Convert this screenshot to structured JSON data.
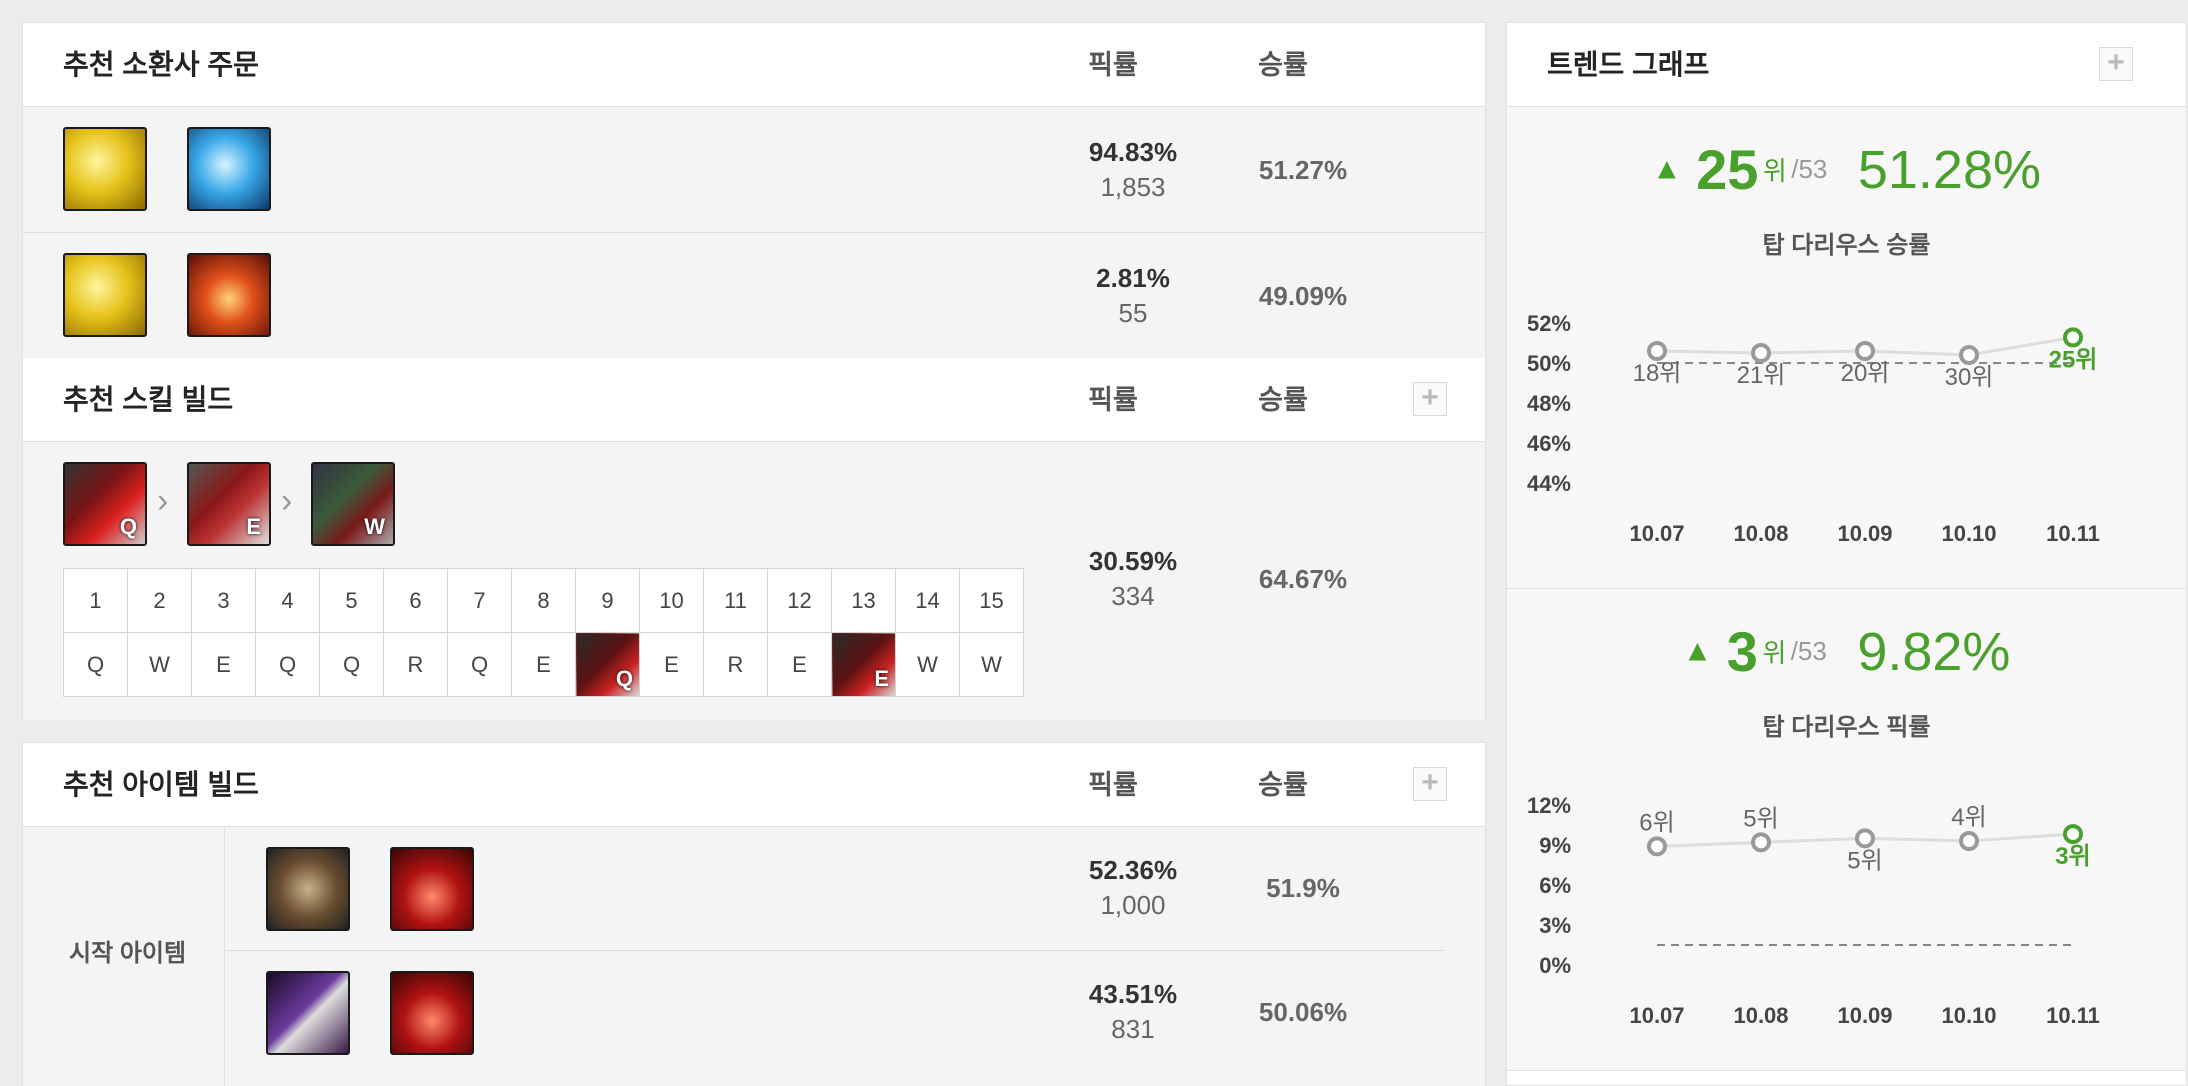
{
  "spells": {
    "title": "추천 소환사 주문",
    "col_pick": "픽률",
    "col_win": "승률",
    "rows": [
      {
        "icons": [
          "ghost-spell-icon",
          "cleanse-spell-icon"
        ],
        "pick": "94.83%",
        "count": "1,853",
        "win": "51.27%"
      },
      {
        "icons": [
          "ghost-spell-icon",
          "ignite-spell-icon"
        ],
        "pick": "2.81%",
        "count": "55",
        "win": "49.09%"
      }
    ]
  },
  "skills": {
    "title": "추천 스킬 빌드",
    "col_pick": "픽률",
    "col_win": "승률",
    "plus": "+",
    "order": [
      "Q",
      "E",
      "W"
    ],
    "levels": [
      "1",
      "2",
      "3",
      "4",
      "5",
      "6",
      "7",
      "8",
      "9",
      "10",
      "11",
      "12",
      "13",
      "14",
      "15"
    ],
    "keys": [
      "Q",
      "W",
      "E",
      "Q",
      "Q",
      "R",
      "Q",
      "E",
      "Q",
      "E",
      "R",
      "E",
      "E",
      "W",
      "W"
    ],
    "highlight_levels": [
      9,
      13
    ],
    "pick": "30.59%",
    "count": "334",
    "win": "64.67%"
  },
  "items": {
    "title": "추천 아이템 빌드",
    "col_pick": "픽률",
    "col_win": "승률",
    "plus": "+",
    "start_label": "시작 아이템",
    "rows": [
      {
        "icons": [
          "dorans-shield-icon",
          "health-potion-icon"
        ],
        "pick": "52.36%",
        "count": "1,000",
        "win": "51.9%"
      },
      {
        "icons": [
          "long-sword-icon",
          "health-potion-icon"
        ],
        "pick": "43.51%",
        "count": "831",
        "win": "50.06%"
      }
    ]
  },
  "trend": {
    "title": "트렌드 그래프",
    "plus": "+",
    "win_block": {
      "rank": "25",
      "rank_unit": "위",
      "total": "/53",
      "rate": "51.28%",
      "subtitle": "탑 다리우스 승률"
    },
    "pick_block": {
      "rank": "3",
      "rank_unit": "위",
      "total": "/53",
      "rate": "9.82%",
      "subtitle": "탑 다리우스 픽률"
    }
  },
  "chart_data": [
    {
      "type": "line",
      "x": [
        "10.07",
        "10.08",
        "10.09",
        "10.10",
        "10.11"
      ],
      "y_ticks": [
        "52%",
        "50%",
        "48%",
        "46%",
        "44%"
      ],
      "ylim": [
        44,
        52
      ],
      "values": [
        50.6,
        50.5,
        50.6,
        50.4,
        51.28
      ],
      "point_labels": [
        "18위",
        "21위",
        "20위",
        "30위",
        "25위"
      ],
      "reference": 50
    },
    {
      "type": "line",
      "x": [
        "10.07",
        "10.08",
        "10.09",
        "10.10",
        "10.11"
      ],
      "y_ticks": [
        "12%",
        "9%",
        "6%",
        "3%",
        "0%"
      ],
      "ylim": [
        0,
        12
      ],
      "values": [
        8.9,
        9.2,
        9.5,
        9.3,
        9.82
      ],
      "point_labels": [
        "6위",
        "5위",
        "5위",
        "4위",
        "3위"
      ],
      "reference": 1.5
    }
  ],
  "colors": {
    "accent": "#4aa02c",
    "point": "#999999",
    "line": "#dddddd"
  }
}
